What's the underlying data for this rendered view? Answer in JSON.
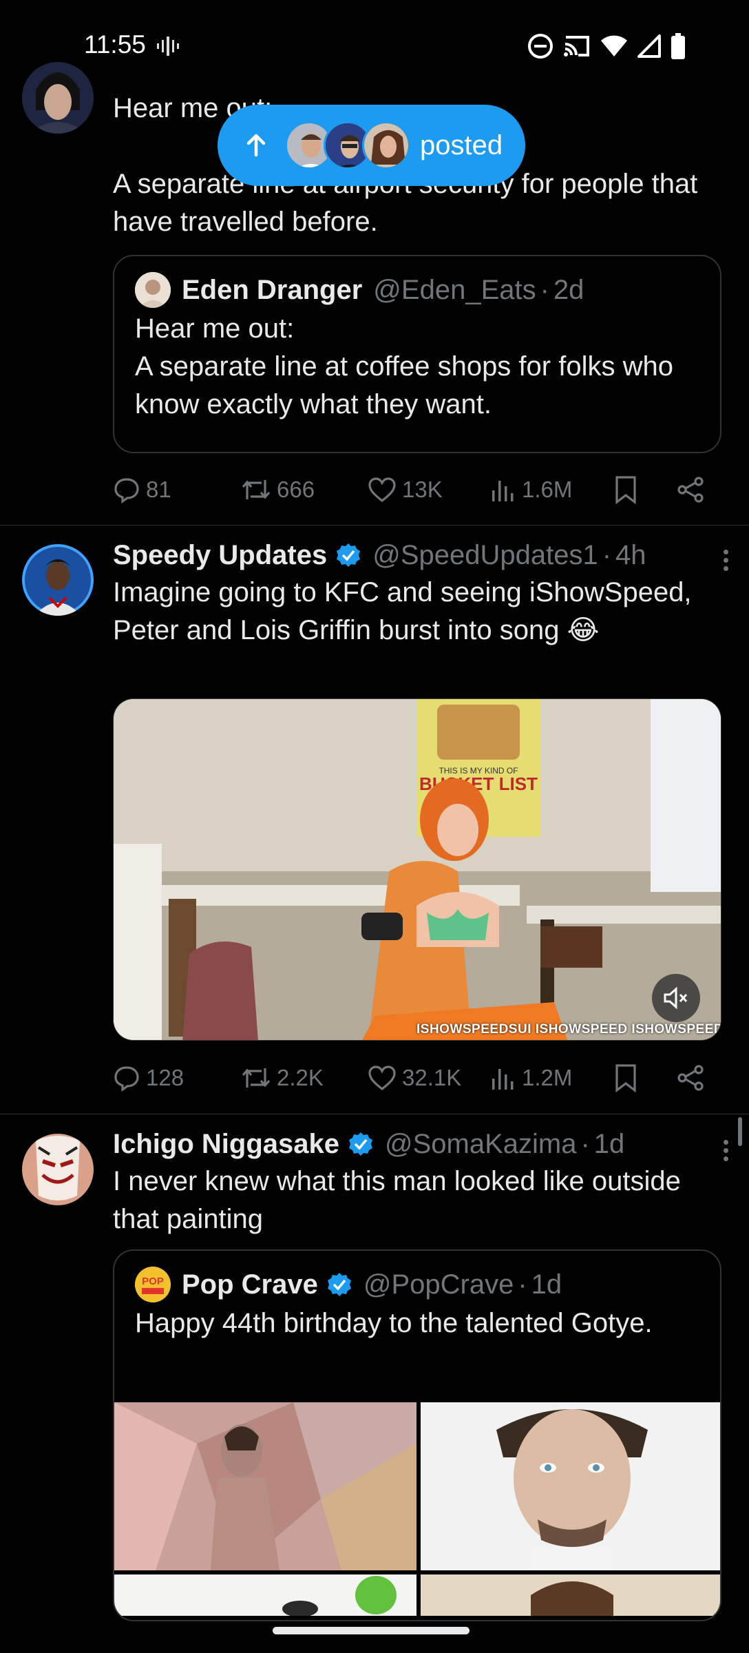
{
  "status_bar": {
    "time": "11:55",
    "icons": [
      "vibrate-icon",
      "dnd-icon",
      "cast-icon",
      "wifi-icon",
      "signal-icon",
      "battery-icon"
    ]
  },
  "new_posts_pill": {
    "label": "posted",
    "icon": "arrow-up-icon"
  },
  "tweets": [
    {
      "text": "Hear me out:\n\nA separate line at airport security for people that have travelled before.",
      "quote": {
        "name": "Eden Dranger",
        "handle": "@Eden_Eats",
        "sep": "·",
        "time": "2d",
        "text": "Hear me out:\nA separate line at coffee shops for folks who know exactly what they want."
      },
      "stats": {
        "replies": "81",
        "reposts": "666",
        "likes": "13K",
        "views": "1.6M"
      }
    },
    {
      "name": "Speedy Updates",
      "handle": "@SpeedUpdates1",
      "sep": "·",
      "time": "4h",
      "text": "Imagine going to KFC and seeing iShowSpeed, Peter and Lois Griffin burst into song 😂",
      "media": {
        "sign_line1": "THIS IS MY KIND OF",
        "sign_line2": "BUCKET LIST",
        "watermark": "ISHOWSPEEDSUI  ISHOWSPEED  ISHOWSPEED"
      },
      "stats": {
        "replies": "128",
        "reposts": "2.2K",
        "likes": "32.1K",
        "views": "1.2M"
      }
    },
    {
      "name": "Ichigo Niggasake",
      "handle": "@SomaKazima",
      "sep": "·",
      "time": "1d",
      "text": "I never knew what this man looked like outside that painting",
      "quote": {
        "name": "Pop Crave",
        "handle": "@PopCrave",
        "sep": "·",
        "time": "1d",
        "text": "Happy 44th birthday to the talented Gotye.",
        "avatar_text": "POP"
      }
    }
  ],
  "colors": {
    "accent": "#1d9bf0",
    "muted": "#71767b",
    "border": "#2f3336"
  }
}
